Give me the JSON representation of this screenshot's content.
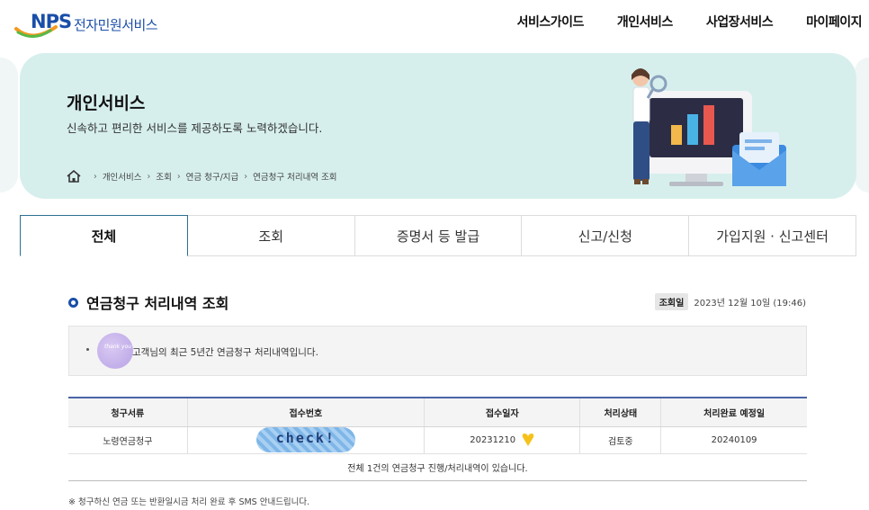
{
  "header": {
    "logo_brand": "NPS",
    "logo_text": "전자민원서비스",
    "nav": [
      "서비스가이드",
      "개인서비스",
      "사업장서비스",
      "마이페이지"
    ]
  },
  "banner": {
    "title": "개인서비스",
    "subtitle": "신속하고 편리한 서비스를 제공하도록 노력하겠습니다.",
    "breadcrumb": [
      "개인서비스",
      "조회",
      "연금 청구/지급",
      "연금청구 처리내역 조회"
    ]
  },
  "tabs": [
    {
      "label": "전체",
      "active": true
    },
    {
      "label": "조회",
      "active": false
    },
    {
      "label": "증명서 등 발급",
      "active": false
    },
    {
      "label": "신고/신청",
      "active": false
    },
    {
      "label": "가입지원 · 신고센터",
      "active": false
    }
  ],
  "section": {
    "title": "연금청구 처리내역 조회",
    "inquiry_label": "조회일",
    "inquiry_date": "2023년 12월 10일 (19:46)"
  },
  "notice": {
    "message": "고객님의 최근 5년간 연금청구 처리내역입니다."
  },
  "table": {
    "headers": [
      "청구서류",
      "접수번호",
      "접수일자",
      "처리상태",
      "처리완료 예정일"
    ],
    "rows": [
      [
        "노령연금청구",
        "check!",
        "20231210",
        "검토중",
        "20240109"
      ]
    ],
    "summary": "전체 1건의 연금청구 진행/처리내역이 있습니다."
  },
  "footnote": "※ 청구하신 연금 또는 반환일시금 처리 완료 후 SMS 안내드립니다.",
  "colors": {
    "brand_blue": "#1a4ea8",
    "banner_bg": "#d6efed",
    "table_top_border": "#4a64a8"
  }
}
